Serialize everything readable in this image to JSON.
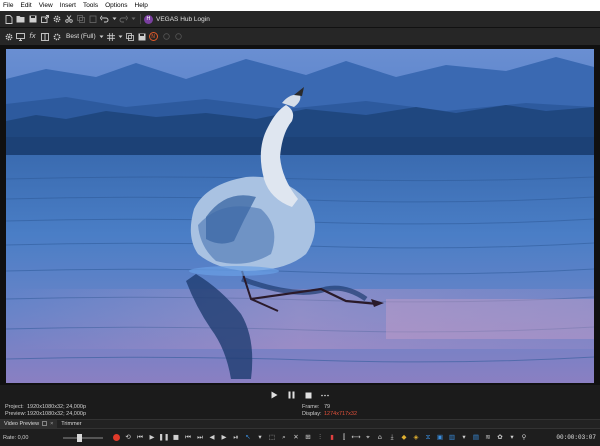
{
  "menu": [
    "File",
    "Edit",
    "View",
    "Insert",
    "Tools",
    "Options",
    "Help"
  ],
  "toolbar": {
    "hub_badge": "H",
    "hub_label": "VEGAS Hub Login"
  },
  "preview_toolbar": {
    "fx_label": "fx",
    "quality": "Best (Full)",
    "badge": "N"
  },
  "info": {
    "project_label": "Project:",
    "project_value": "1920x1080x32; 24,000p",
    "preview_label": "Preview:",
    "preview_value": "1920x1080x32; 24,000p",
    "frame_label": "Frame:",
    "frame_value": "79",
    "display_label": "Display:",
    "display_value": "1274x717x32"
  },
  "tabs": [
    {
      "label": "Video Preview",
      "active": true
    },
    {
      "label": "Trimmer",
      "active": false
    }
  ],
  "bottom": {
    "rate": "Rate: 0,00",
    "timecode": "00:00:03:07"
  },
  "colors": {
    "accent_red": "#e0503a",
    "hub_purple": "#7a3fa0",
    "record_red": "#e03a2a"
  }
}
